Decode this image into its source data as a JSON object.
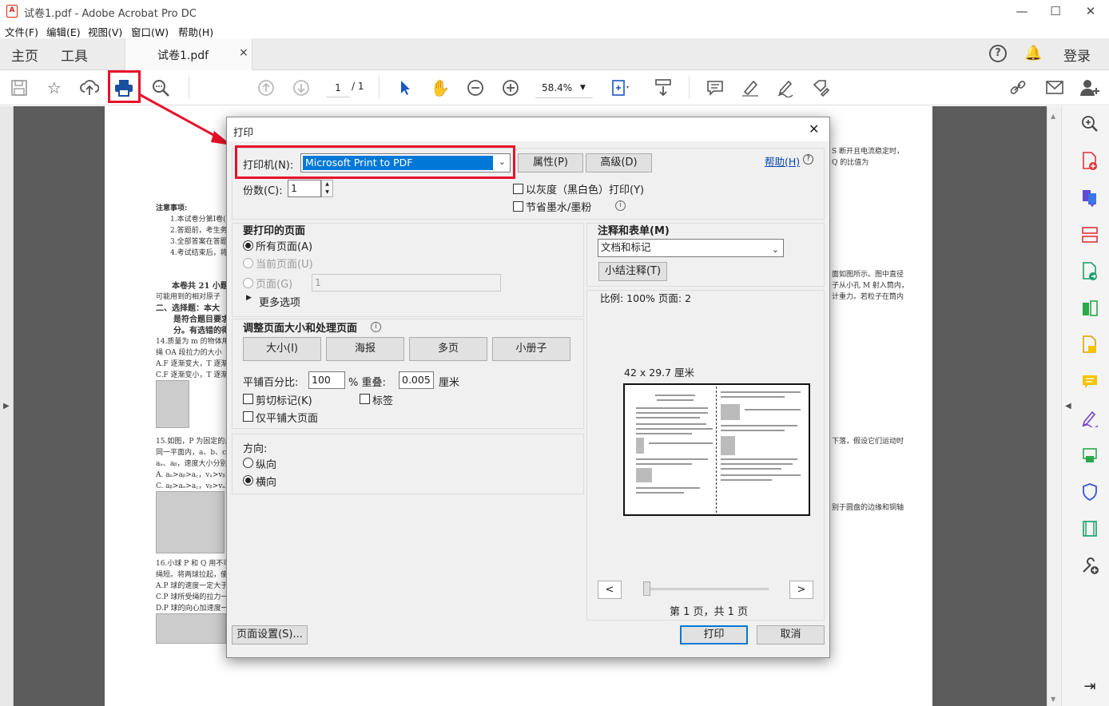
{
  "window": {
    "title": "试卷1.pdf - Adobe Acrobat Pro DC",
    "app_icon_glyph": "A",
    "controls": {
      "minimize": "—",
      "maximize": "☐",
      "close": "✕"
    }
  },
  "menu": [
    "文件(F)",
    "编辑(E)",
    "视图(V)",
    "窗口(W)",
    "帮助(H)"
  ],
  "tabs": {
    "home": "主页",
    "tools": "工具",
    "doc": "试卷1.pdf",
    "close": "×",
    "login": "登录"
  },
  "toolbar": {
    "page_current": "1",
    "page_total": "/ 1",
    "zoom": "58.4%",
    "icons": [
      "save-icon",
      "star-icon",
      "upload-icon",
      "print-icon",
      "search-zoom-icon",
      "page-up-icon",
      "page-down-icon",
      "pointer-icon",
      "hand-icon",
      "zoom-out-icon",
      "zoom-in-icon",
      "fit-page-icon",
      "scroll-mode-icon",
      "comment-icon",
      "highlight-icon",
      "sign-icon",
      "edit-icon",
      "share-link-icon",
      "email-icon",
      "add-user-icon"
    ],
    "accent": "#e8102a"
  },
  "document_fragments": {
    "notice_title": "注意事项:",
    "notice_1": "1.本试卷分第Ⅰ卷(",
    "notice_2": "2.答题前，考生务",
    "notice_3": "3.全部答案在答题",
    "notice_4": "4.考试结束后，将",
    "total": "本卷共 21 小题",
    "mass_note": "可能用到的相对原子",
    "section2": "二、选择题：本大",
    "section2b": "是符合题目要求",
    "section2c": "分。有选错的得",
    "q14": "14.质量为 m 的物体用",
    "q14b": "绳 OA 段拉力的大小",
    "q14A": "A.F 逐渐变大，T 逐渐",
    "q14C": "C.F 逐渐变小，T 逐渐",
    "q15": "15.如图，P 为固定的点",
    "q15b": "同一平面内，a、b、c",
    "q15c": "aₐ、aᵦ，速度大小分别",
    "q15A": "A. aₐ>aᵦ>a꜀，vₐ>vᵦ>v",
    "q15C": "C. aᵦ>aₐ>a꜀，vᵦ>vₐ>v",
    "q16": "16.小球 P 和 Q 用不可",
    "q16b": "绳短。将两球拉起，使",
    "q16A": "A.P 球的速度一定大于",
    "q16C": "C.P 球所受绳的拉力一",
    "q16D": "D.P 球的向心加速度一",
    "right1": "S 断开且电流稳定时，",
    "right2": "Q 的比值为",
    "right3": "面如图所示。图中直径",
    "right4": "子从小孔 M 射入筒内，",
    "right5": "计重力。若粒子在筒内",
    "right6": "下落，假设它们运动时",
    "right7": "别于圆盘的边缘和铜轴"
  },
  "dialog": {
    "title": "打印",
    "close": "✕",
    "printer_label": "打印机(N):",
    "printer_value": "Microsoft Print to PDF",
    "properties": "属性(P)",
    "advanced": "高级(D)",
    "help": "帮助(H)",
    "copies_label": "份数(C):",
    "copies_value": "1",
    "grayscale": "以灰度（黑白色）打印(Y)",
    "save_ink": "节省墨水/墨粉",
    "pages_title": "要打印的页面",
    "all_pages": "所有页面(A)",
    "current_page": "当前页面(U)",
    "pages": "页面(G)",
    "pages_value": "1",
    "more_options": "更多选项",
    "sizing_title": "调整页面大小和处理页面",
    "size_btn": "大小(I)",
    "poster_btn": "海报",
    "multiple_btn": "多页",
    "booklet_btn": "小册子",
    "tile_scale_label": "平铺百分比:",
    "tile_scale_value": "100",
    "overlap_label": "% 重叠:",
    "overlap_value": "0.005",
    "overlap_unit": "厘米",
    "cut_marks": "剪切标记(K)",
    "labels": "标签",
    "tile_large": "仅平铺大页面",
    "orientation_title": "方向:",
    "portrait": "纵向",
    "landscape": "横向",
    "comments_title": "注释和表单(M)",
    "comments_value": "文档和标记",
    "summarize": "小结注释(T)",
    "scale_info": "比例:  100% 页面:  2",
    "paper_size": "42 x 29.7 厘米",
    "prev": "<",
    "next": ">",
    "page_of": "第 1 页，共 1 页",
    "page_setup": "页面设置(S)...",
    "print": "打印",
    "cancel": "取消"
  }
}
